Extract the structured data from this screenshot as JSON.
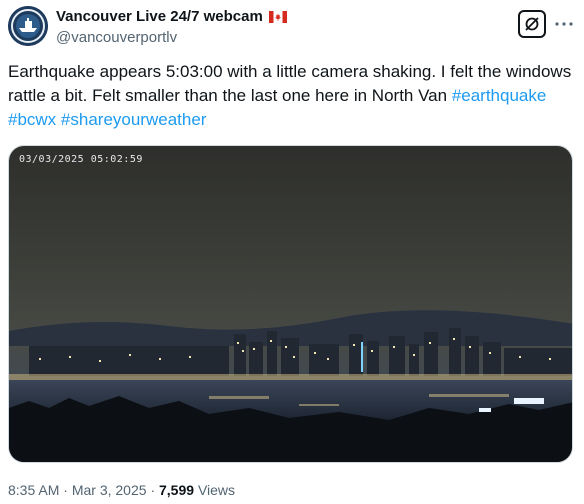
{
  "author": {
    "display_name": "Vancouver Live 24/7 webcam",
    "handle": "@vancouverportlv",
    "flag_icon": "canada-flag-icon"
  },
  "tweet": {
    "text_main": "Earthquake appears 5:03:00 with a little camera shaking. I felt the windows rattle a bit. Felt smaller than the last one here in North Van ",
    "hashtags": [
      "#earthquake",
      "#bcwx",
      "#shareyourweather"
    ]
  },
  "media": {
    "overlay_timestamp": "03/03/2025 05:02:59"
  },
  "meta": {
    "time": "8:35 AM",
    "separator": "·",
    "date": "Mar 3, 2025",
    "views_count": "7,599",
    "views_label": "Views"
  },
  "colors": {
    "accent": "#1d9bf0",
    "muted": "#536471"
  }
}
